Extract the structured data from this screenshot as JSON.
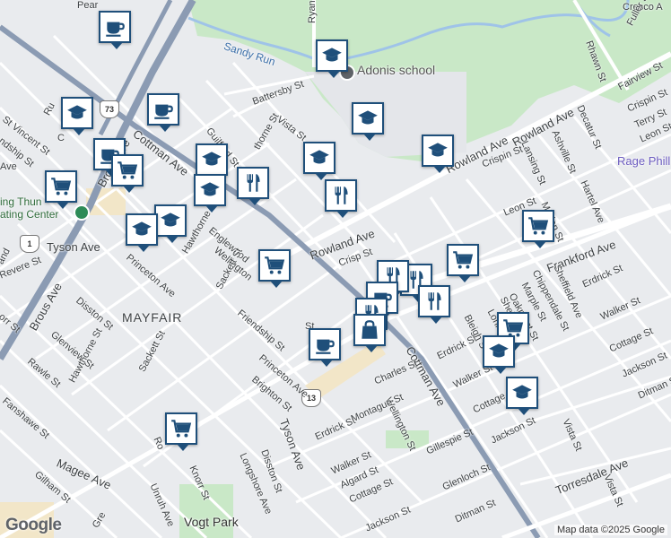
{
  "attribution": "Map data ©2025 Google",
  "logo": "Google",
  "areas": {
    "neighborhood": "MAYFAIR"
  },
  "pois": {
    "adonis_school": "Adonis school",
    "rage_phill": "Rage Phill",
    "ice_center": "ing Thun\nating Center",
    "vogt_park": "Vogt Park",
    "sandy_run": "Sandy Run",
    "cresco": "Cresco A"
  },
  "route_shields": [
    "73",
    "13",
    "1"
  ],
  "streets": {
    "cottman_ave_1": "Cottman Ave",
    "cottman_ave_2": "Cottman Ave",
    "rowland_ave_1": "Rowland Ave",
    "rowland_ave_2": "Rowland Ave",
    "rowland_ave_3": "Rowland Ave",
    "frankford_ave": "Frankford Ave",
    "torresdale_ave": "Torresdale Ave",
    "tyson_ave_1": "Tyson Ave",
    "tyson_ave_2": "Tyson Ave",
    "brous_ave_1": "Brous Ave",
    "brous_ave_2": "Brous Ave",
    "magee_ave": "Magee Ave",
    "ryan_ave": "Ryan Ave",
    "rhawn_st": "Rhawn St",
    "fuller_st": "Fuller St",
    "fairview_st": "Fairview St",
    "crispin_st_1": "Crispin St",
    "crispin_st_2": "Crispin St",
    "terry_st": "Terry St",
    "leon_st_1": "Leon St",
    "leon_st_2": "Leon St",
    "decatur_st": "Decatur St",
    "ashville_st": "Ashville St",
    "hartel_ave": "Hartel Ave",
    "lansing_st": "Lansing St",
    "merion_st": "Merion St",
    "sheffield_ave": "Sheffield Ave",
    "erdrick_st_1": "Erdrick St",
    "erdrick_st_2": "Erdrick St",
    "erdrick_st_3": "Erdrick St",
    "walker_st_1": "Walker St",
    "walker_st_2": "Walker St",
    "walker_st_3": "Walker St",
    "cottage_st_1": "Cottage St",
    "cottage_st_2": "Cottage St",
    "cottage_st_3": "Cottage St",
    "jackson_st_1": "Jackson St",
    "jackson_st_2": "Jackson St",
    "jackson_st_3": "Jackson St",
    "ditman_st_1": "Ditman St",
    "ditman_st_2": "Ditman St",
    "chippendale_st": "Chippendale St",
    "marple_st": "Marple St",
    "oakmont_st": "Oakmont St",
    "lorina_st": "Lorina St",
    "bleigh_st": "Bleigh S",
    "shelm_st": "Shelm",
    "vista_st_1": "Vista St",
    "vista_st_2": "Vista St",
    "vista_st_3": "Vista St",
    "battersby_st": "Battersby St",
    "guilford_st": "Guilford St",
    "hawthorne_st_1": "thorne St",
    "hawthorne_st_2": "Hawthorne St",
    "hawthorne_st_3": "Hawthorne St",
    "englewood_st": "Englewood",
    "wellington_st_1": "Wellington",
    "wellington_st_2": "Wellington St",
    "sackett_st_1": "Sackett St",
    "sackett_st_2": "Sackett St",
    "friendship_st_1": "Friendship St",
    "friendship_st_2": "ndship St",
    "princeton_ave_1": "Princeton Ave",
    "princeton_ave_2": "Princeton Ave",
    "brighton_st": "Brighton St",
    "disston_st_1": "Disston St",
    "disston_st_2": "Disston St",
    "revere_st": "Revere St",
    "glenview_st": "Glenview St",
    "rawle_st": "Rawle St",
    "fanshawe_st": "Fanshawe St",
    "gilham_st": "Gilham St",
    "st_vincent_st": "St Vincent St",
    "charles_st": "Charles St",
    "montague_st": "Montague St",
    "algard_st": "Algard St",
    "gillespie_st": "Gillespie St",
    "glenloch_st": "Glenloch St",
    "longshore_ave": "Longshore Ave",
    "unruh_ave": "Unruh Ave",
    "knorr_st": "Knorr St",
    "crispin_frag": "Crisp St",
    "rorrer_frag": "Ro",
    "st_frag": "St",
    "te_frag": "Te",
    "c_frag": "C",
    "ru_frag": "Ru",
    "orr_frag": "orr St",
    "ave_frag": "Ave",
    "gre_frag": "Gre",
    "and_frag": "and",
    "pear_frag": "Pear"
  },
  "pins": [
    {
      "type": "coffee",
      "icon": "coffee-icon"
    },
    {
      "type": "school",
      "icon": "school-icon"
    },
    {
      "type": "coffee",
      "icon": "coffee-icon"
    },
    {
      "type": "school",
      "icon": "school-icon"
    },
    {
      "type": "school",
      "icon": "school-icon"
    },
    {
      "type": "school",
      "icon": "school-icon"
    },
    {
      "type": "coffee",
      "icon": "coffee-icon"
    },
    {
      "type": "grocery",
      "icon": "cart-icon"
    },
    {
      "type": "school",
      "icon": "school-icon"
    },
    {
      "type": "restaurant",
      "icon": "restaurant-icon"
    },
    {
      "type": "school",
      "icon": "school-icon"
    },
    {
      "type": "restaurant",
      "icon": "restaurant-icon"
    },
    {
      "type": "grocery",
      "icon": "cart-icon"
    },
    {
      "type": "school",
      "icon": "school-icon"
    },
    {
      "type": "school",
      "icon": "school-icon"
    },
    {
      "type": "school",
      "icon": "school-icon"
    },
    {
      "type": "grocery",
      "icon": "cart-icon"
    },
    {
      "type": "grocery",
      "icon": "cart-icon"
    },
    {
      "type": "grocery",
      "icon": "cart-icon"
    },
    {
      "type": "restaurant",
      "icon": "restaurant-icon"
    },
    {
      "type": "restaurant",
      "icon": "restaurant-icon"
    },
    {
      "type": "restaurant",
      "icon": "restaurant-icon"
    },
    {
      "type": "coffee",
      "icon": "coffee-icon"
    },
    {
      "type": "restaurant",
      "icon": "restaurant-icon"
    },
    {
      "type": "shopping",
      "icon": "shopping-bag-icon"
    },
    {
      "type": "coffee",
      "icon": "coffee-icon"
    },
    {
      "type": "grocery",
      "icon": "cart-icon"
    },
    {
      "type": "school",
      "icon": "school-icon"
    },
    {
      "type": "school",
      "icon": "school-icon"
    },
    {
      "type": "grocery",
      "icon": "cart-icon"
    }
  ],
  "colors": {
    "pin_border": "#1f4f7a",
    "park": "#c9e8c7",
    "road": "#ffffff",
    "major_road": "#8b9bb3"
  }
}
